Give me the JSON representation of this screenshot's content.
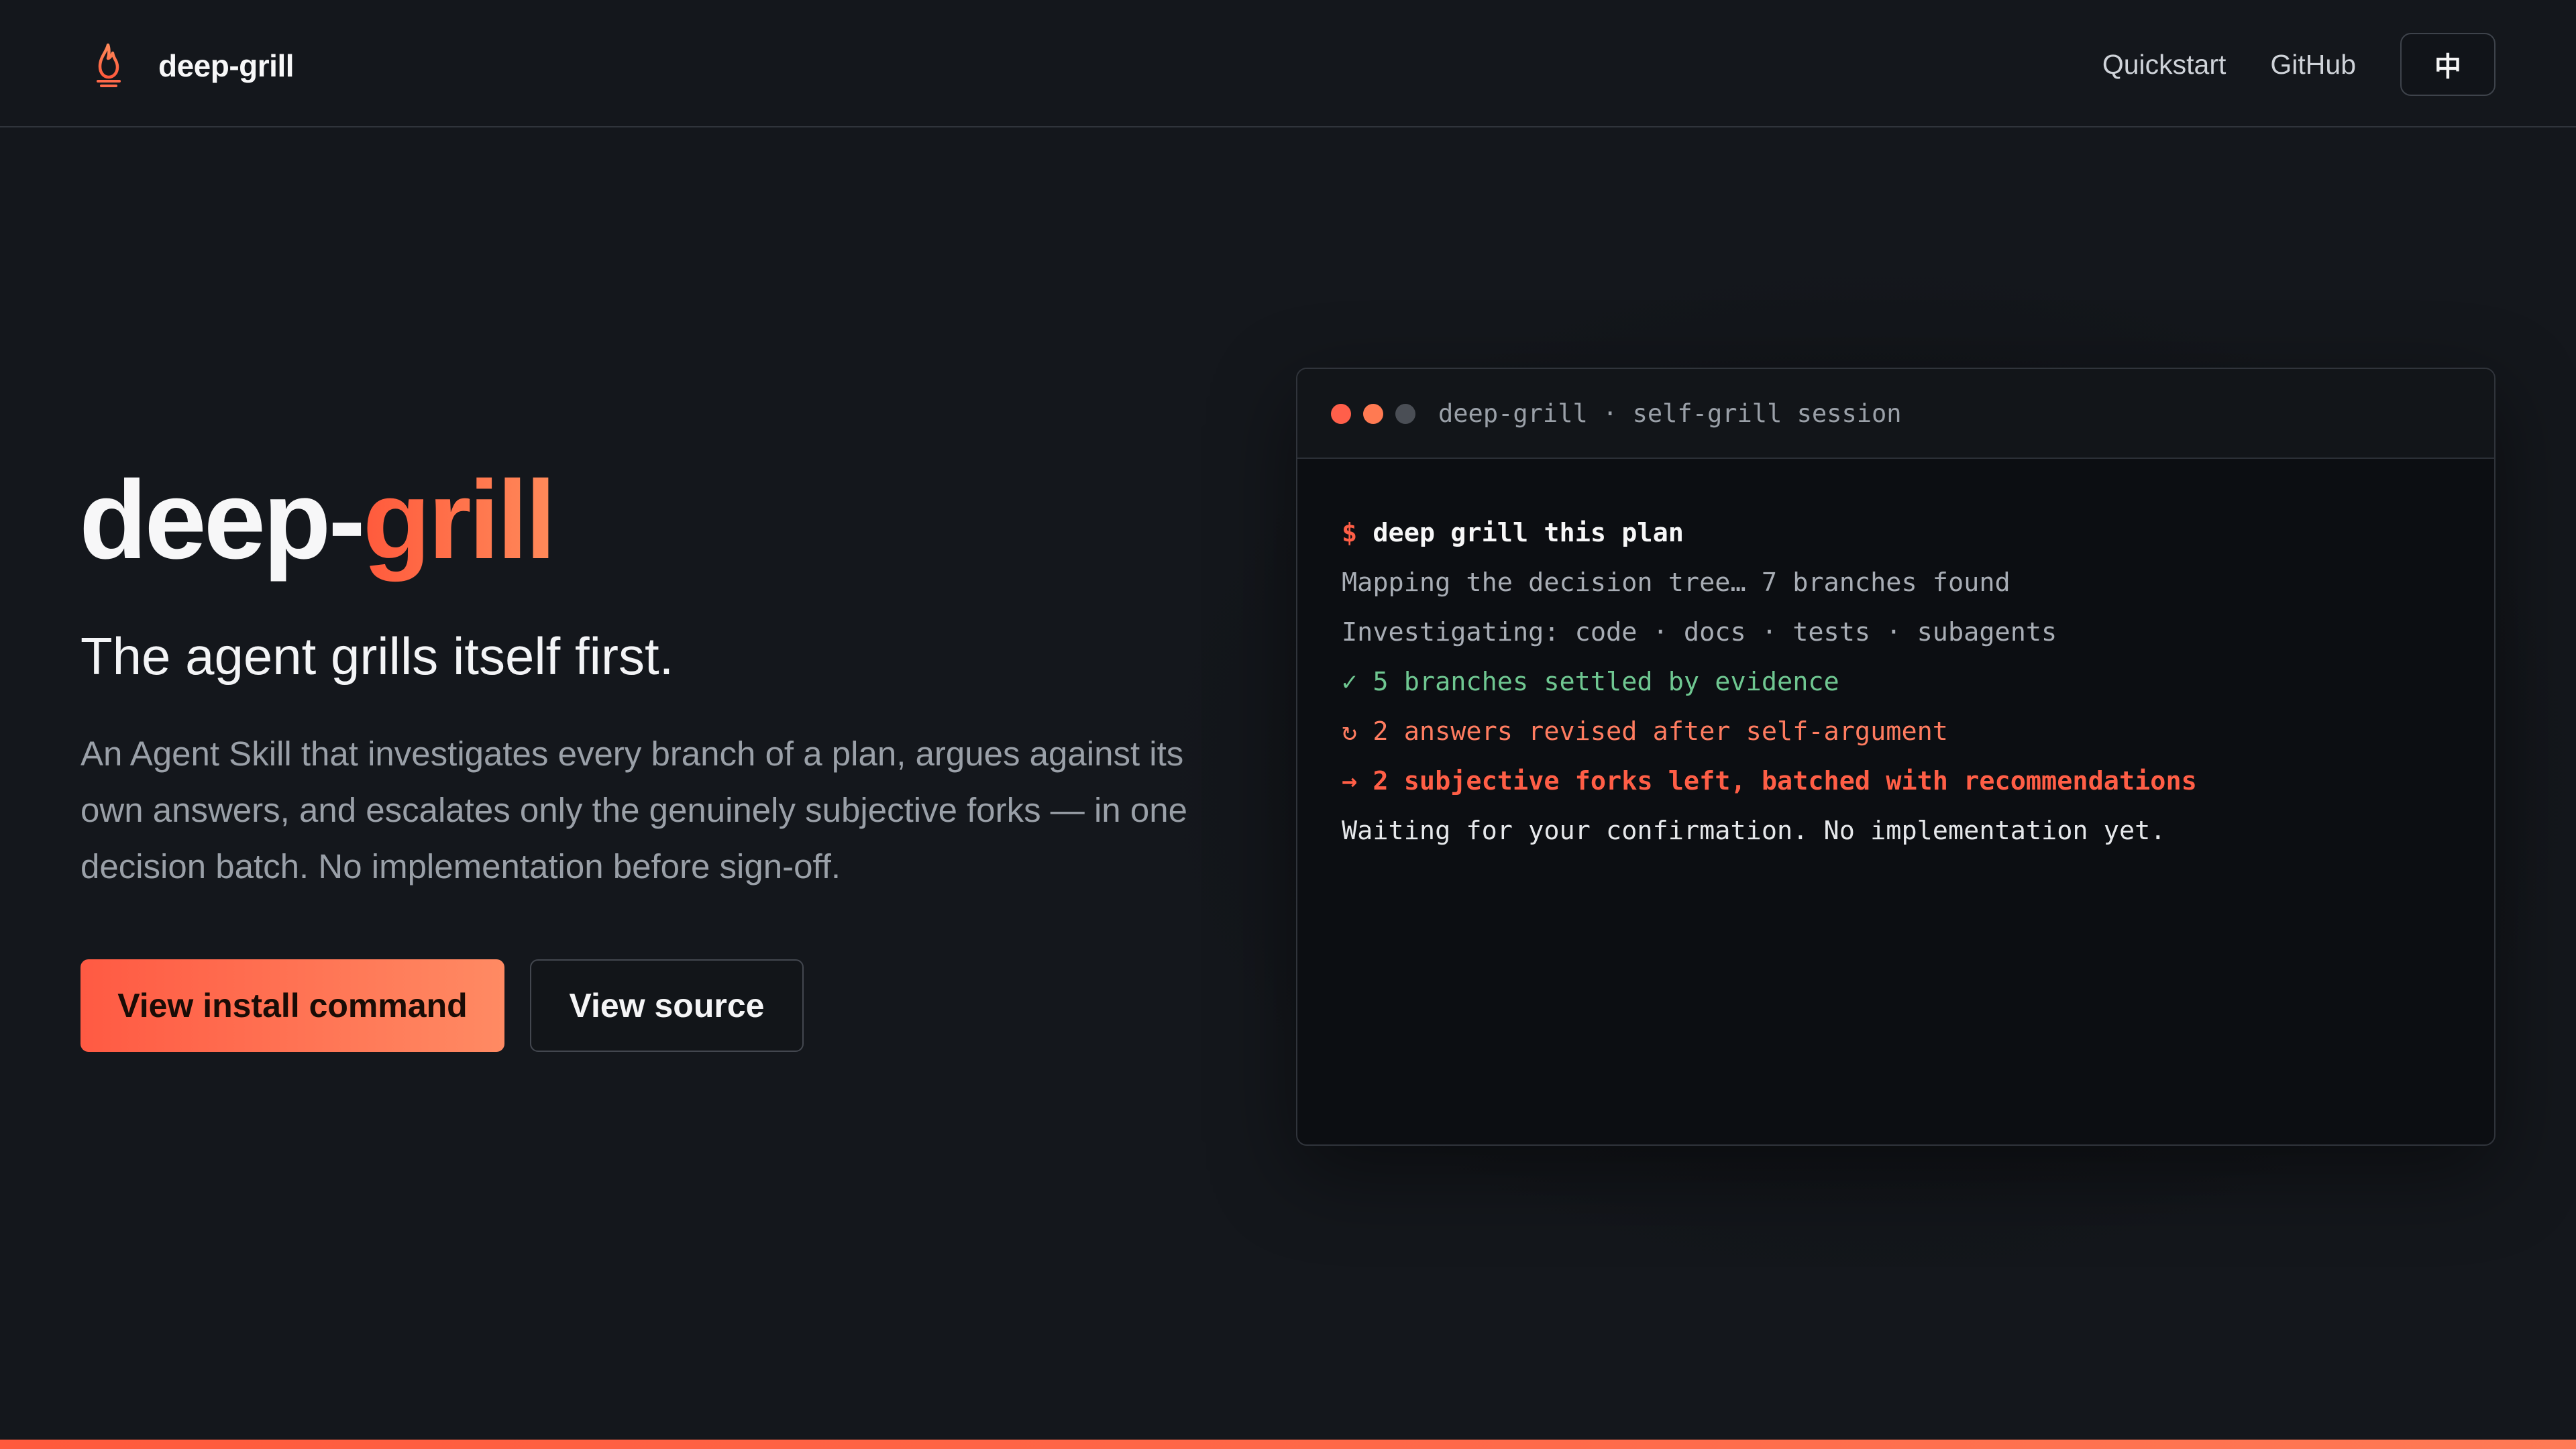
{
  "header": {
    "brand_name": "deep-grill",
    "brand_icon": "flame-icon",
    "nav": {
      "quickstart": "Quickstart",
      "github": "GitHub",
      "language": "中"
    }
  },
  "hero": {
    "title_prefix": "deep-",
    "title_accent": "grill",
    "tagline": "The agent grills itself first.",
    "description": "An Agent Skill that investigates every branch of a plan, argues against its own answers, and escalates only the genuinely subjective forks — in one decision batch. No implementation before sign-off.",
    "primary_button": "View install command",
    "secondary_button": "View source"
  },
  "terminal": {
    "title": "deep-grill · self-grill session",
    "prompt_symbol": "$",
    "command": "deep grill this plan",
    "lines": [
      {
        "text": "Mapping the decision tree… 7 branches found",
        "tone": "muted"
      },
      {
        "text": "Investigating: code · docs · tests · subagents",
        "tone": "muted"
      },
      {
        "text": "✓ 5 branches settled by evidence",
        "tone": "green"
      },
      {
        "text": "↻ 2 answers revised after self-argument",
        "tone": "orange"
      },
      {
        "text": "→ 2 subjective forks left, batched with recommendations",
        "tone": "red"
      },
      {
        "text": "Waiting for your confirmation. No implementation yet.",
        "tone": "white"
      }
    ]
  },
  "colors": {
    "background": "#14171c",
    "accent": "#ff5a3c",
    "accent_light": "#ff8a5a",
    "success": "#6fc791",
    "terminal_bg": "#0c0e12"
  }
}
